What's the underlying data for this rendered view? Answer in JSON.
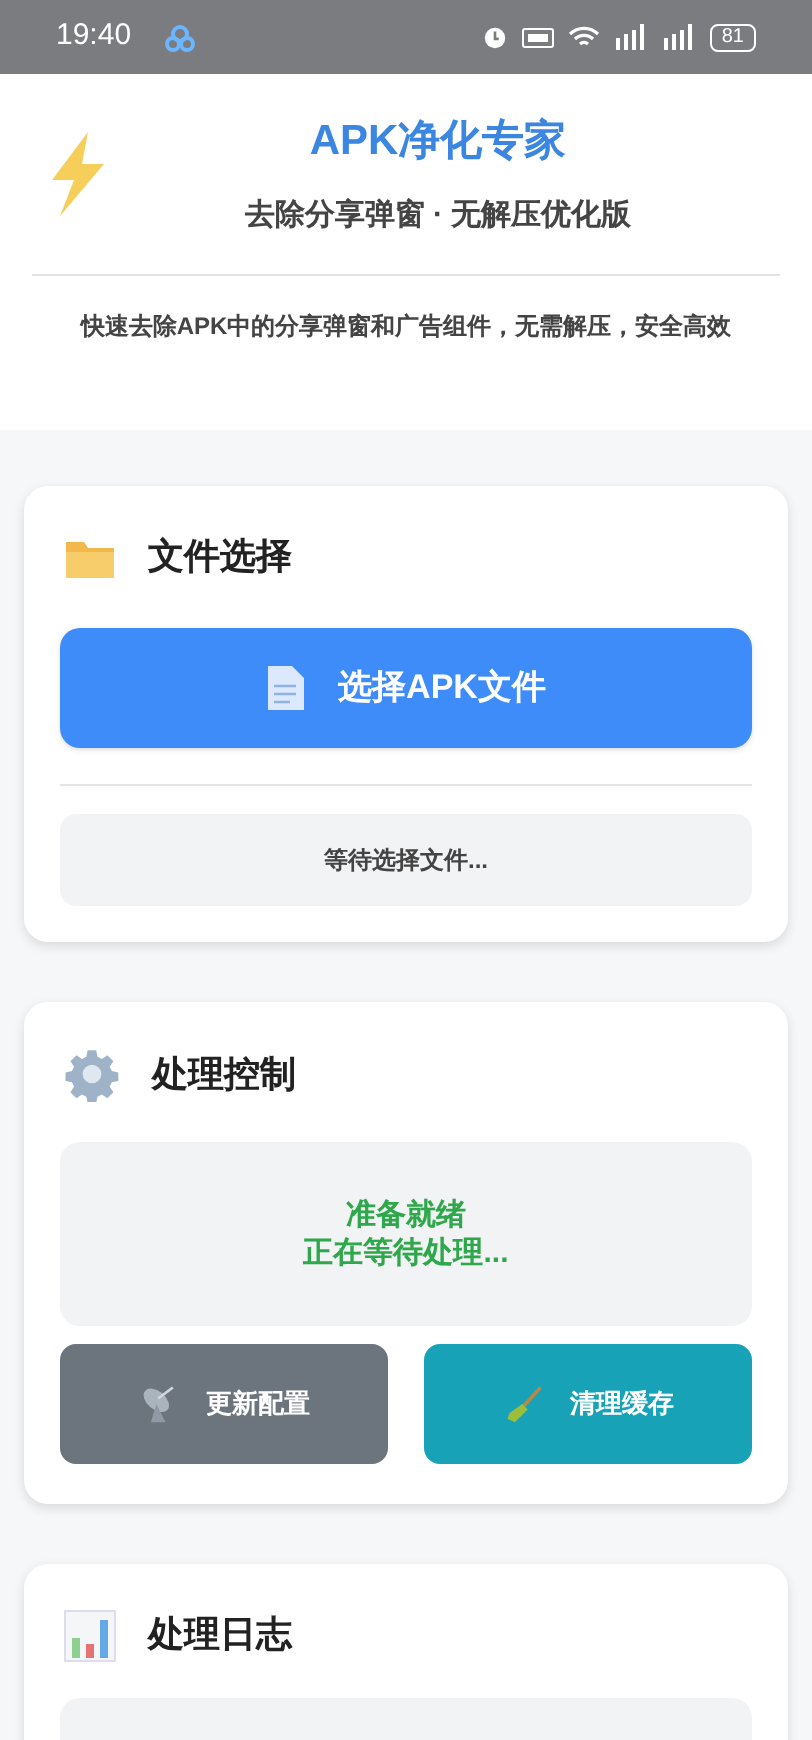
{
  "status_bar": {
    "time": "19:40",
    "battery": "81"
  },
  "header": {
    "title": "APK净化专家",
    "subtitle": "去除分享弹窗 · 无解压优化版",
    "description": "快速去除APK中的分享弹窗和广告组件，无需解压，安全高效"
  },
  "file_card": {
    "title": "文件选择",
    "button": "选择APK文件",
    "status": "等待选择文件..."
  },
  "control_card": {
    "title": "处理控制",
    "status_lines": [
      "准备就绪",
      "正在等待处理..."
    ],
    "buttons": [
      {
        "label": "更新配置",
        "kind": "update"
      },
      {
        "label": "清理缓存",
        "kind": "clean"
      }
    ]
  },
  "log_card": {
    "title": "处理日志"
  }
}
